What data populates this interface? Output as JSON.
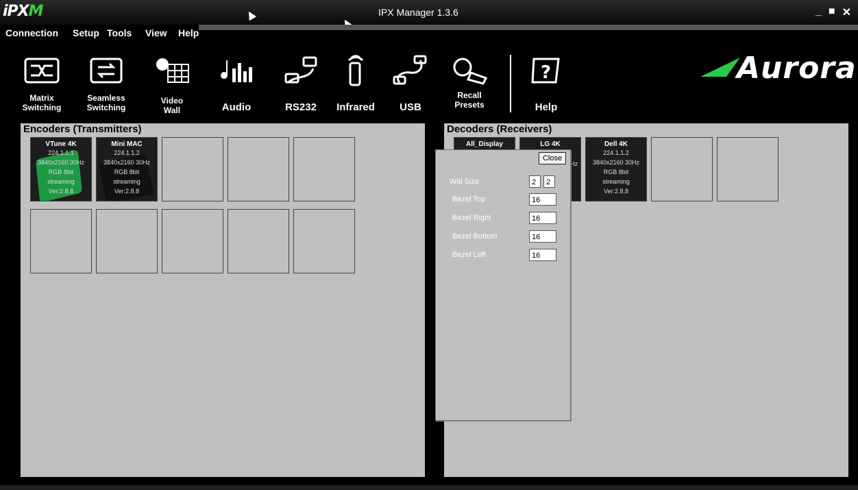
{
  "window": {
    "logo_prefix": "iPX",
    "logo_suffix": "M",
    "title": "IPX Manager 1.3.6",
    "minimize": "_",
    "maximize": "■",
    "close": "✕"
  },
  "menu": [
    "Connection",
    "Setup",
    "Tools",
    "View",
    "Help"
  ],
  "toolbar": [
    {
      "label1": "Matrix",
      "label2": "Switching",
      "icon": "matrix-switching-icon"
    },
    {
      "label1": "Seamless",
      "label2": "Switching",
      "icon": "seamless-switching-icon"
    },
    {
      "label1": "Video",
      "label2": "Wall",
      "icon": "video-wall-icon"
    },
    {
      "label1": "",
      "label2": "Audio",
      "icon": "audio-icon"
    },
    {
      "label1": "",
      "label2": "RS232",
      "icon": "rs232-icon"
    },
    {
      "label1": "",
      "label2": "Infrared",
      "icon": "infrared-icon"
    },
    {
      "label1": "",
      "label2": "USB",
      "icon": "usb-icon"
    },
    {
      "label1": "Recall",
      "label2": "Presets",
      "icon": "recall-presets-icon"
    },
    {
      "label1": "",
      "label2": "Help",
      "icon": "help-icon"
    }
  ],
  "brand": "Aurora",
  "encoders": {
    "title": "Encoders (Transmitters)",
    "devices": [
      {
        "name": "VTune 4K",
        "ip": "224.1.1.1",
        "res": "3840x2160 30Hz",
        "color": "RGB 8bit",
        "state": "streaming",
        "ver": "Ver:2.8.8"
      },
      {
        "name": "Mini MAC",
        "ip": "224.1.1.2",
        "res": "3840x2160 30Hz",
        "color": "RGB 8bit",
        "state": "streaming",
        "ver": "Ver:2.8.8"
      }
    ]
  },
  "decoders": {
    "title": "Decoders (Receivers)",
    "devices": [
      {
        "name": "All_Display"
      },
      {
        "name": "LG 4K",
        "partial": "Hz"
      },
      {
        "name": "Dell 4K",
        "ip": "224.1.1.2",
        "res": "3840x2160 30Hz",
        "color": "RGB 8bit",
        "state": "streaming",
        "ver": "Ver:2.8.8"
      }
    ]
  },
  "wall_dialog": {
    "close": "Close",
    "wall_size_label": "Wal Size",
    "wall_cols": "2",
    "wall_rows": "2",
    "fields": [
      {
        "label": "Bezel Top",
        "value": "16"
      },
      {
        "label": "Bezel Right",
        "value": "16"
      },
      {
        "label": "Bezel Bottom",
        "value": "16"
      },
      {
        "label": "Bezel Left",
        "value": "16"
      }
    ]
  }
}
